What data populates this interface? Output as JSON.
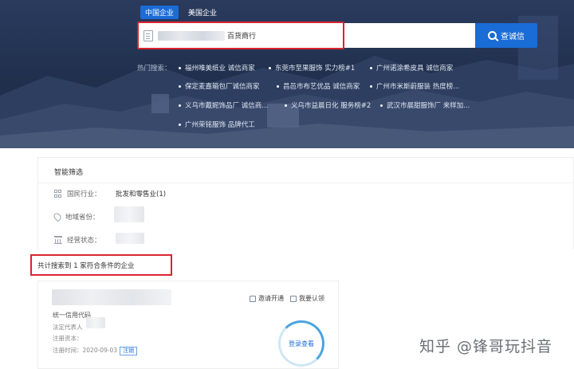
{
  "tabs": [
    {
      "label": "中国企业",
      "active": true
    },
    {
      "label": "美国企业",
      "active": false
    }
  ],
  "search": {
    "value_suffix": "百货商行",
    "button_label": "查诚信"
  },
  "hot_search": {
    "label": "热门搜索：",
    "items": [
      "福州唯美纸业 诚信商家",
      "东莞市至果服饰 实力榜#1",
      "广州诺涂希皮具 诚信商家",
      "保定麦嘉箱包厂诚信商家",
      "昌邑市布艺优品 诚信商家",
      "广州市米斯蔚服装 热度榜...",
      "义乌市戴妮饰品厂 诚信商...",
      "义乌市益晨日化 服务榜#2",
      "武汉市晨甜服饰厂 来样加...",
      "广州荣铭服饰 品牌代工"
    ]
  },
  "filter": {
    "title": "智能筛选",
    "rows": [
      {
        "label": "国民行业：",
        "value": "批发和零售业(1)"
      },
      {
        "label": "地域省份：",
        "value": ""
      },
      {
        "label": "经营状态：",
        "value": ""
      }
    ]
  },
  "result_count": "共计搜索到 1 家符合条件的企业",
  "result": {
    "credit_code_label": "统一信用代码",
    "legal_rep_label": "法定代表人",
    "reg_capital_label": "注册资本：",
    "reg_time_label": "注册时间：",
    "reg_time": "2020-09-03",
    "status_tag": "注销",
    "action_invite": "邀请开通",
    "action_claim": "我要认领",
    "login_label": "登录查看"
  },
  "watermark": "知乎 @锋哥玩抖音",
  "colors": {
    "accent": "#1a6cd6",
    "highlight": "#d9252f"
  }
}
